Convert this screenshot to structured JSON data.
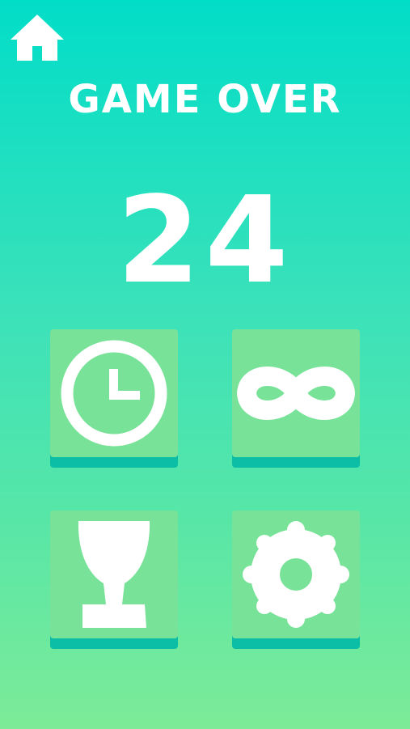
{
  "header": {
    "home_icon": "home-icon"
  },
  "title": "GAME OVER",
  "score": "24",
  "menu": {
    "items": [
      {
        "id": "timed-mode",
        "icon": "clock-icon"
      },
      {
        "id": "endless-mode",
        "icon": "infinity-icon"
      },
      {
        "id": "leaderboard",
        "icon": "trophy-icon"
      },
      {
        "id": "settings",
        "icon": "gear-icon"
      }
    ]
  },
  "colors": {
    "background_top": "#02ddc8",
    "background_bottom": "#7deb98",
    "tile_face": "#78e398",
    "tile_shadow": "#0cbea5",
    "foreground": "#ffffff"
  }
}
